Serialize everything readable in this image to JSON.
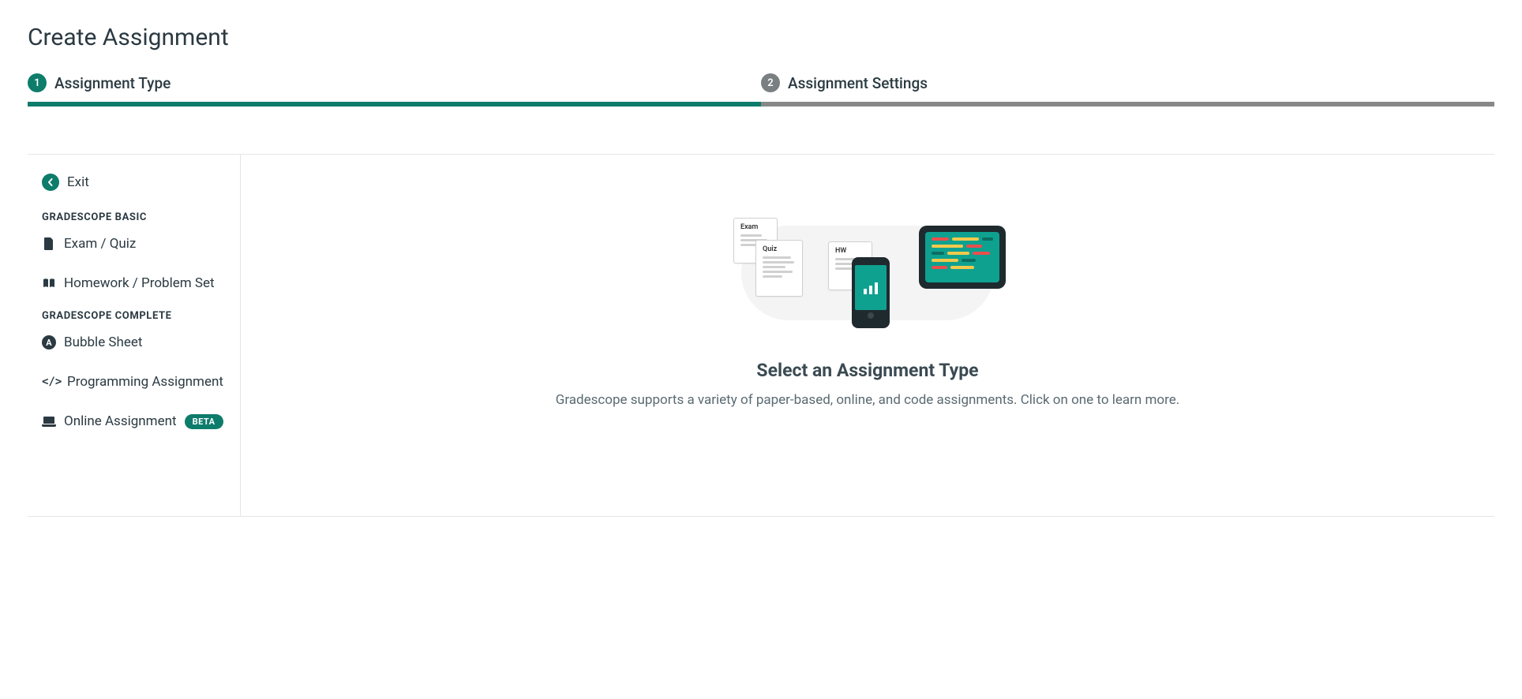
{
  "page_title": "Create Assignment",
  "stepper": [
    {
      "num": "1",
      "label": "Assignment Type",
      "active": true
    },
    {
      "num": "2",
      "label": "Assignment Settings",
      "active": false
    }
  ],
  "sidebar": {
    "exit_label": "Exit",
    "sections": [
      {
        "heading": "GRADESCOPE BASIC",
        "items": [
          {
            "icon": "document-icon",
            "label": "Exam / Quiz"
          },
          {
            "icon": "book-icon",
            "label": "Homework / Problem Set"
          }
        ]
      },
      {
        "heading": "GRADESCOPE COMPLETE",
        "items": [
          {
            "icon": "bubble-letter-icon",
            "icon_letter": "A",
            "label": "Bubble Sheet"
          },
          {
            "icon": "code-icon",
            "label": "Programming Assignment"
          },
          {
            "icon": "laptop-icon",
            "label": "Online Assignment",
            "badge": "BETA"
          }
        ]
      }
    ]
  },
  "illustration": {
    "doc_labels": {
      "exam": "Exam",
      "quiz": "Quiz",
      "hw": "HW"
    }
  },
  "main": {
    "title": "Select an Assignment Type",
    "description": "Gradescope supports a variety of paper-based, online, and code assignments. Click on one to learn more."
  },
  "colors": {
    "accent": "#0e7c6b",
    "teal": "#0fa190",
    "text": "#2b3a42",
    "muted": "#7a7f82"
  }
}
